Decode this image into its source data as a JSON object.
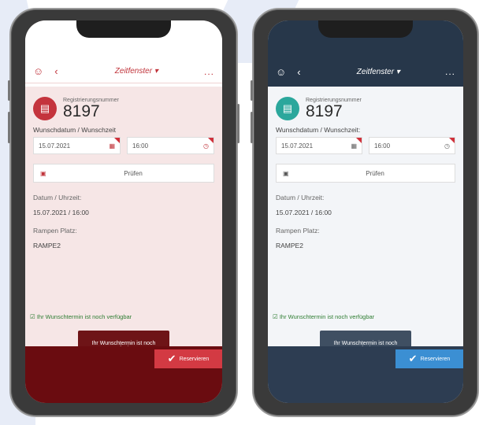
{
  "screen_left": {
    "nav": {
      "user_icon": "user-icon",
      "back_icon": "back-icon",
      "title": "Zeitfenster ▾",
      "more": "..."
    },
    "reg": {
      "label": "Registrierungsnummer",
      "number": "8197"
    },
    "wish_label": "Wunschdatum / Wunschzeit",
    "date_value": "15.07.2021",
    "time_value": "16:00",
    "pruefen_label": "Prüfen",
    "datum_label": "Datum / Uhrzeit:",
    "datum_value": "15.07.2021 / 16:00",
    "rampe_label": "Rampen Platz:",
    "rampe_value": "RAMPE2",
    "availability": "Ihr Wunschtermin ist noch verfügbar",
    "toast": "Ihr Wunschtermin ist noch verfügbar",
    "reserve": "Reservieren",
    "colors": {
      "accent": "#c4343d",
      "footer": "#6a0c10"
    }
  },
  "screen_right": {
    "nav": {
      "user_icon": "user-icon",
      "back_icon": "back-icon",
      "title": "Zeitfenster ▾",
      "more": "..."
    },
    "reg": {
      "label": "Registrierungsnummer",
      "number": "8197"
    },
    "wish_label": "Wunschdatum / Wunschzeit:",
    "date_value": "15.07.2021",
    "time_value": "16:00",
    "pruefen_label": "Prüfen",
    "datum_label": "Datum / Uhrzeit:",
    "datum_value": "15.07.2021 / 16:00",
    "rampe_label": "Rampen Platz:",
    "rampe_value": "RAMPE2",
    "availability": "Ihr Wunschtermin ist noch verfügbar",
    "toast": "Ihr Wunschtermin ist noch verfügbar",
    "reserve": "Reservieren",
    "colors": {
      "accent": "#2ba79c",
      "footer": "#2d3d52"
    }
  }
}
